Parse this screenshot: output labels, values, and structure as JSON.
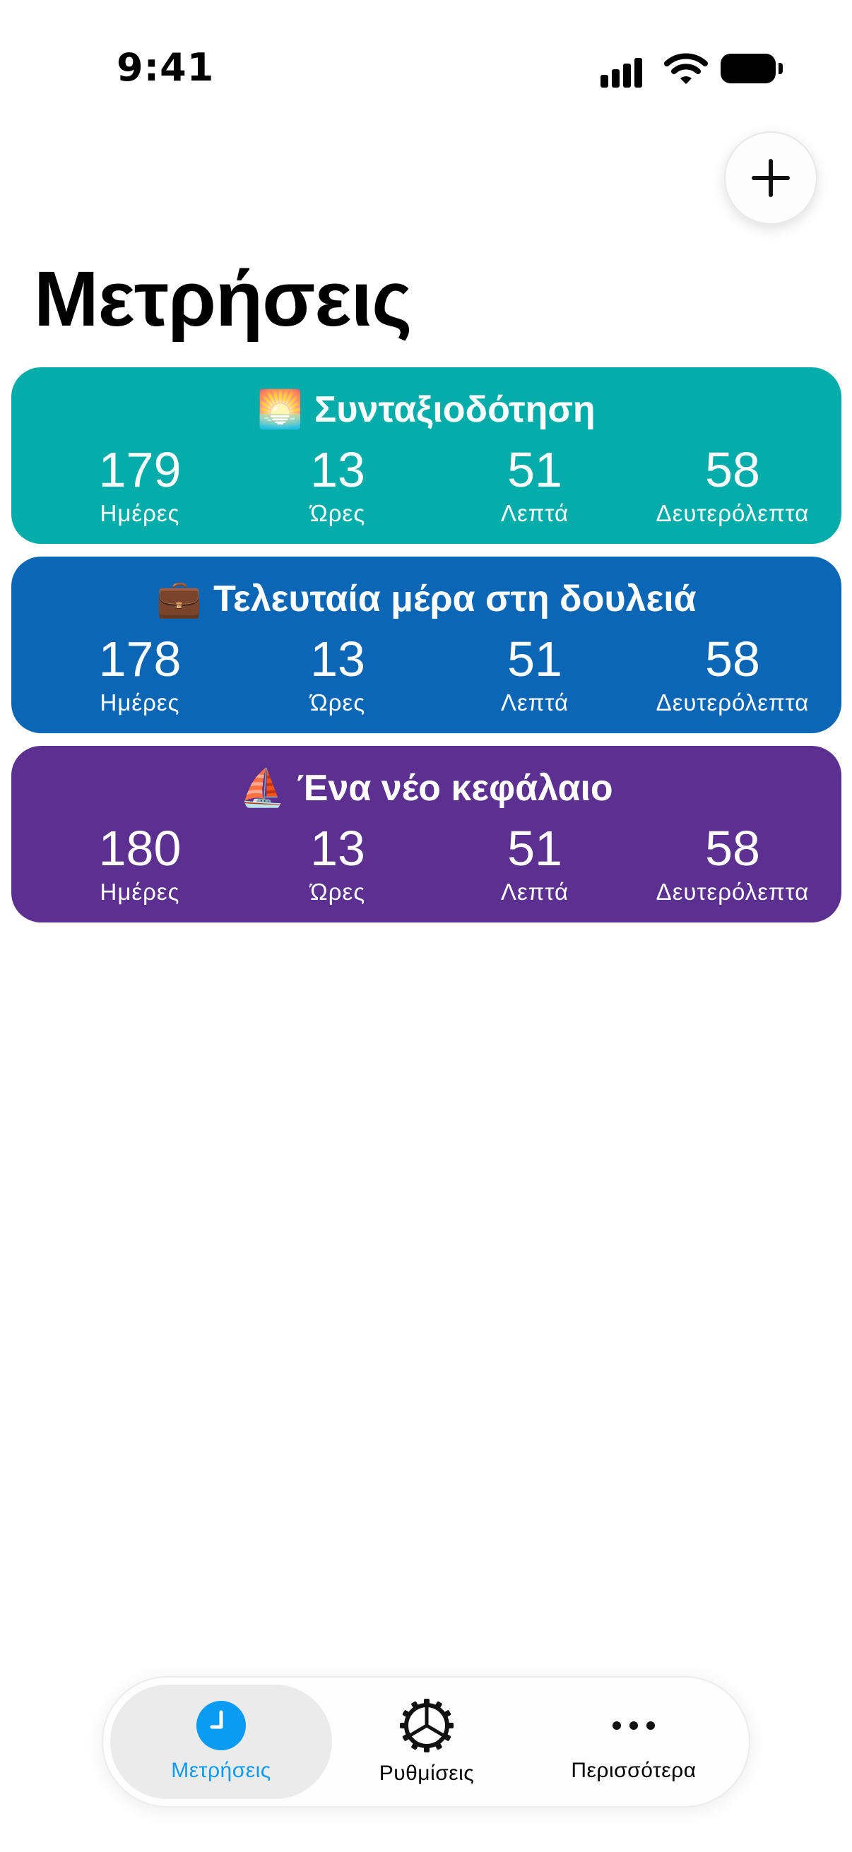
{
  "status_bar": {
    "time": "9:41"
  },
  "header": {
    "title": "Μετρήσεις",
    "add_icon": "plus-icon"
  },
  "counters": [
    {
      "emoji": "🌅",
      "title": "Συνταξιοδότηση",
      "color": "#04ADAA",
      "units": [
        {
          "value": "179",
          "label": "Ημέρες"
        },
        {
          "value": "13",
          "label": "Ώρες"
        },
        {
          "value": "51",
          "label": "Λεπτά"
        },
        {
          "value": "58",
          "label": "Δευτερόλεπτα"
        }
      ]
    },
    {
      "emoji": "💼",
      "title": "Τελευταία μέρα στη δουλειά",
      "color": "#0B66B5",
      "units": [
        {
          "value": "178",
          "label": "Ημέρες"
        },
        {
          "value": "13",
          "label": "Ώρες"
        },
        {
          "value": "51",
          "label": "Λεπτά"
        },
        {
          "value": "58",
          "label": "Δευτερόλεπτα"
        }
      ]
    },
    {
      "emoji": "⛵",
      "title": "Ένα νέο κεφάλαιο",
      "color": "#5B3091",
      "units": [
        {
          "value": "180",
          "label": "Ημέρες"
        },
        {
          "value": "13",
          "label": "Ώρες"
        },
        {
          "value": "51",
          "label": "Λεπτά"
        },
        {
          "value": "58",
          "label": "Δευτερόλεπτα"
        }
      ]
    }
  ],
  "tab_bar": {
    "tabs": [
      {
        "label": "Μετρήσεις",
        "icon": "clock-icon",
        "active": true
      },
      {
        "label": "Ρυθμίσεις",
        "icon": "gear-icon",
        "active": false
      },
      {
        "label": "Περισσότερα",
        "icon": "more-icon",
        "active": false
      }
    ],
    "accent_color": "#0A9BF5"
  }
}
